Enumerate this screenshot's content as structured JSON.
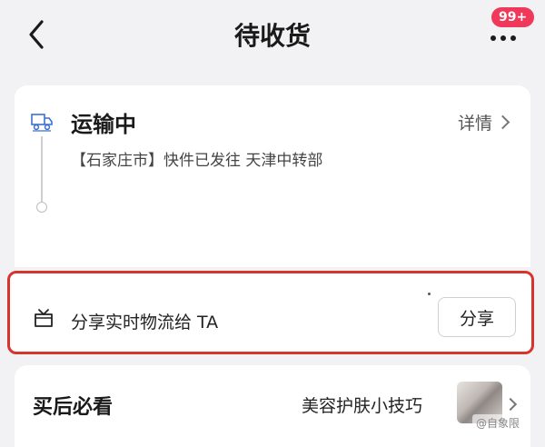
{
  "header": {
    "title": "待收货",
    "back_icon": "chevron-left-icon",
    "more_icon": "more-dots-icon",
    "badge_count": "99+"
  },
  "shipping": {
    "status": "运输中",
    "details_label": "详情",
    "tracking_text": "【石家庄市】快件已发往 天津中转部",
    "status_icon": "truck-icon"
  },
  "share": {
    "label": "分享实时物流给 TA",
    "button_label": "分享",
    "icon": "gift-box-icon"
  },
  "after_sale": {
    "title": "买后必看",
    "tips_label": "美容护肤小技巧"
  },
  "watermark": "@自象限",
  "colors": {
    "badge": "#f0385a",
    "highlight_border": "#d9342b",
    "background": "#f2f2f4"
  }
}
